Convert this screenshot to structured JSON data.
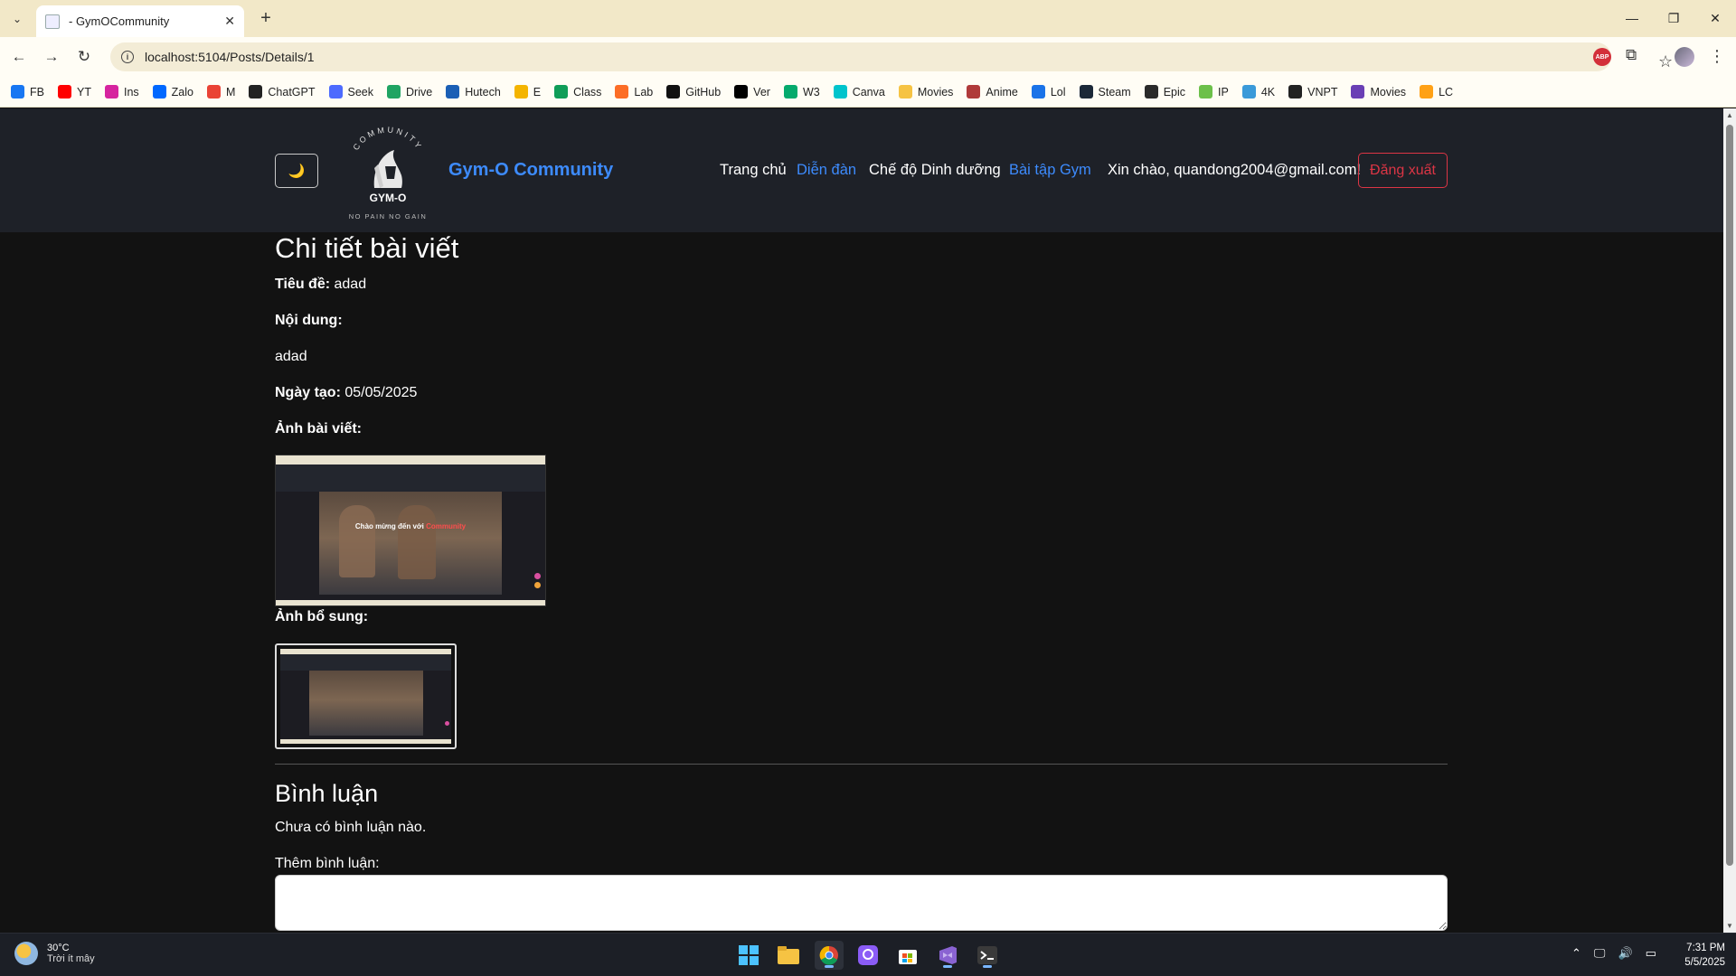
{
  "browser": {
    "tab_title": "- GymOCommunity",
    "url": "localhost:5104/Posts/Details/1",
    "bookmarks": [
      {
        "label": "FB",
        "color": "#1877f2"
      },
      {
        "label": "YT",
        "color": "#ff0000"
      },
      {
        "label": "Ins",
        "color": "#d6249f"
      },
      {
        "label": "Zalo",
        "color": "#0068ff"
      },
      {
        "label": "M",
        "color": "#ea4335"
      },
      {
        "label": "ChatGPT",
        "color": "#222222"
      },
      {
        "label": "Seek",
        "color": "#4d6bfe"
      },
      {
        "label": "Drive",
        "color": "#1fa463"
      },
      {
        "label": "Hutech",
        "color": "#1b5fb5"
      },
      {
        "label": "E",
        "color": "#f4b400"
      },
      {
        "label": "Class",
        "color": "#0f9d58"
      },
      {
        "label": "Lab",
        "color": "#fc6d26"
      },
      {
        "label": "GitHub",
        "color": "#111111"
      },
      {
        "label": "Ver",
        "color": "#000000"
      },
      {
        "label": "W3",
        "color": "#04aa6d"
      },
      {
        "label": "Canva",
        "color": "#00c4cc"
      },
      {
        "label": "Movies",
        "color": "#f6c343"
      },
      {
        "label": "Anime",
        "color": "#b03a3a"
      },
      {
        "label": "Lol",
        "color": "#1a73e8"
      },
      {
        "label": "Steam",
        "color": "#1b2838"
      },
      {
        "label": "Epic",
        "color": "#2a2a2a"
      },
      {
        "label": "IP",
        "color": "#6cc04a"
      },
      {
        "label": "4K",
        "color": "#3a9ad9"
      },
      {
        "label": "VNPT",
        "color": "#222222"
      },
      {
        "label": "Movies",
        "color": "#6a3fb5"
      },
      {
        "label": "LC",
        "color": "#ffa116"
      }
    ]
  },
  "header": {
    "theme_toggle_icon": "🌙",
    "logo_top": "COMMUNITY",
    "logo_mid": "GYM-O",
    "logo_bottom": "NO PAIN NO GAIN",
    "brand": "Gym-O Community",
    "nav": [
      {
        "label": "Trang chủ",
        "color": "#ffffff"
      },
      {
        "label": "Diễn đàn",
        "color": "#3d8bfd"
      },
      {
        "label": "Chế độ Dinh dưỡng",
        "color": "#ffffff"
      },
      {
        "label": "Bài tập Gym",
        "color": "#3d8bfd"
      }
    ],
    "greeting": "Xin chào, quandong2004@gmail.com!",
    "logout": "Đăng xuất"
  },
  "post": {
    "page_title": "Chi tiết bài viết",
    "title_label": "Tiêu đề:",
    "title_value": "adad",
    "content_label": "Nội dung:",
    "content_value": "adad",
    "date_label": "Ngày tạo:",
    "date_value": "05/05/2025",
    "image_label": "Ảnh bài viết:",
    "extra_image_label": "Ảnh bổ sung:",
    "thumbnail_caption_1": "Chào mừng đến với",
    "thumbnail_caption_2": "Community"
  },
  "comments": {
    "title": "Bình luận",
    "empty_text": "Chưa có bình luận nào.",
    "add_label": "Thêm bình luận:",
    "placeholder": ""
  },
  "taskbar": {
    "temperature": "30°C",
    "weather_desc": "Trời ít mây",
    "time": "7:31 PM",
    "date": "5/5/2025"
  }
}
